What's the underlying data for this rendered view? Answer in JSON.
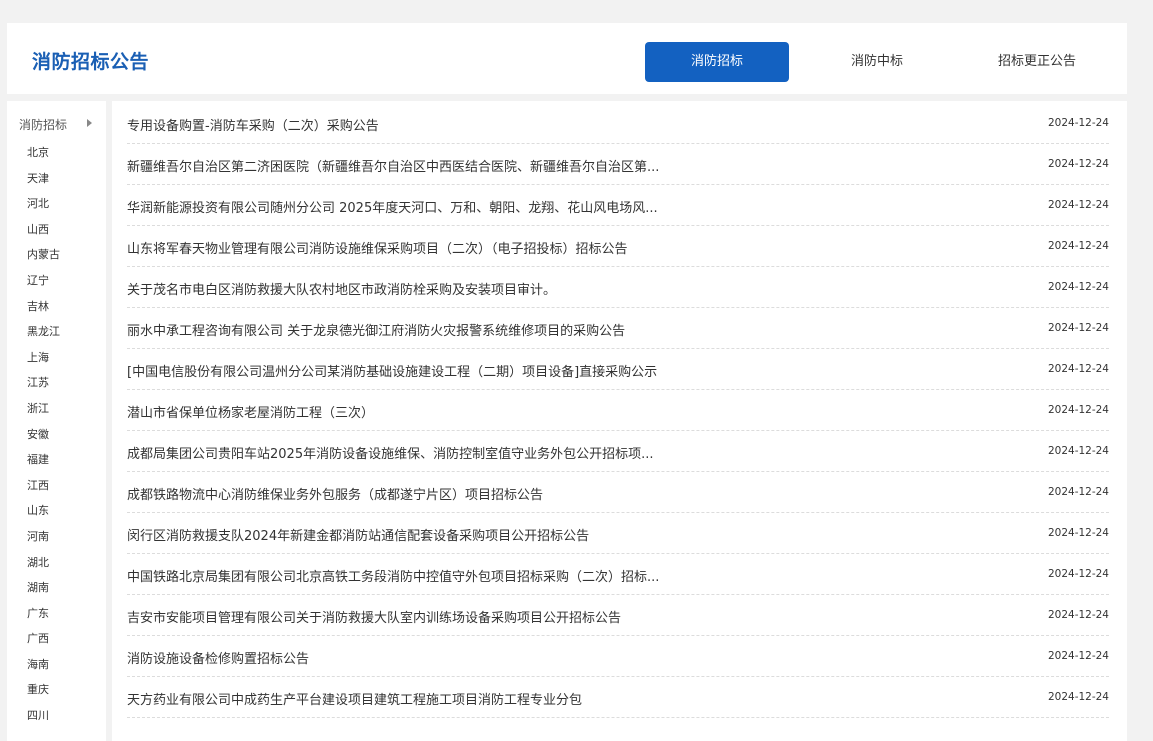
{
  "header": {
    "title": "消防招标公告",
    "tabs": [
      {
        "label": "消防招标",
        "active": true
      },
      {
        "label": "消防中标",
        "active": false
      },
      {
        "label": "招标更正公告",
        "active": false
      }
    ]
  },
  "sidebar": {
    "heading": "消防招标",
    "provinces": [
      "北京",
      "天津",
      "河北",
      "山西",
      "内蒙古",
      "辽宁",
      "吉林",
      "黑龙江",
      "上海",
      "江苏",
      "浙江",
      "安徽",
      "福建",
      "江西",
      "山东",
      "河南",
      "湖北",
      "湖南",
      "广东",
      "广西",
      "海南",
      "重庆",
      "四川"
    ]
  },
  "notices": [
    {
      "title": "专用设备购置-消防车采购（二次）采购公告",
      "date": "2024-12-24"
    },
    {
      "title": "新疆维吾尔自治区第二济困医院（新疆维吾尔自治区中西医结合医院、新疆维吾尔自治区第...",
      "date": "2024-12-24"
    },
    {
      "title": "华润新能源投资有限公司随州分公司 2025年度天河口、万和、朝阳、龙翔、花山风电场风...",
      "date": "2024-12-24"
    },
    {
      "title": "山东将军春天物业管理有限公司消防设施维保采购项目（二次）（电子招投标）招标公告",
      "date": "2024-12-24"
    },
    {
      "title": "关于茂名市电白区消防救援大队农村地区市政消防栓采购及安装项目审计。",
      "date": "2024-12-24"
    },
    {
      "title": "丽水中承工程咨询有限公司 关于龙泉德光御江府消防火灾报警系统维修项目的采购公告",
      "date": "2024-12-24"
    },
    {
      "title": "[中国电信股份有限公司温州分公司某消防基础设施建设工程（二期）项目设备]直接采购公示",
      "date": "2024-12-24"
    },
    {
      "title": "潜山市省保单位杨家老屋消防工程（三次）",
      "date": "2024-12-24"
    },
    {
      "title": "成都局集团公司贵阳车站2025年消防设备设施维保、消防控制室值守业务外包公开招标项...",
      "date": "2024-12-24"
    },
    {
      "title": "成都铁路物流中心消防维保业务外包服务（成都遂宁片区）项目招标公告",
      "date": "2024-12-24"
    },
    {
      "title": "闵行区消防救援支队2024年新建金都消防站通信配套设备采购项目公开招标公告",
      "date": "2024-12-24"
    },
    {
      "title": "中国铁路北京局集团有限公司北京高铁工务段消防中控值守外包项目招标采购（二次）招标...",
      "date": "2024-12-24"
    },
    {
      "title": "吉安市安能项目管理有限公司关于消防救援大队室内训练场设备采购项目公开招标公告",
      "date": "2024-12-24"
    },
    {
      "title": "消防设施设备检修购置招标公告",
      "date": "2024-12-24"
    },
    {
      "title": "天方药业有限公司中成药生产平台建设项目建筑工程施工项目消防工程专业分包",
      "date": "2024-12-24"
    }
  ]
}
